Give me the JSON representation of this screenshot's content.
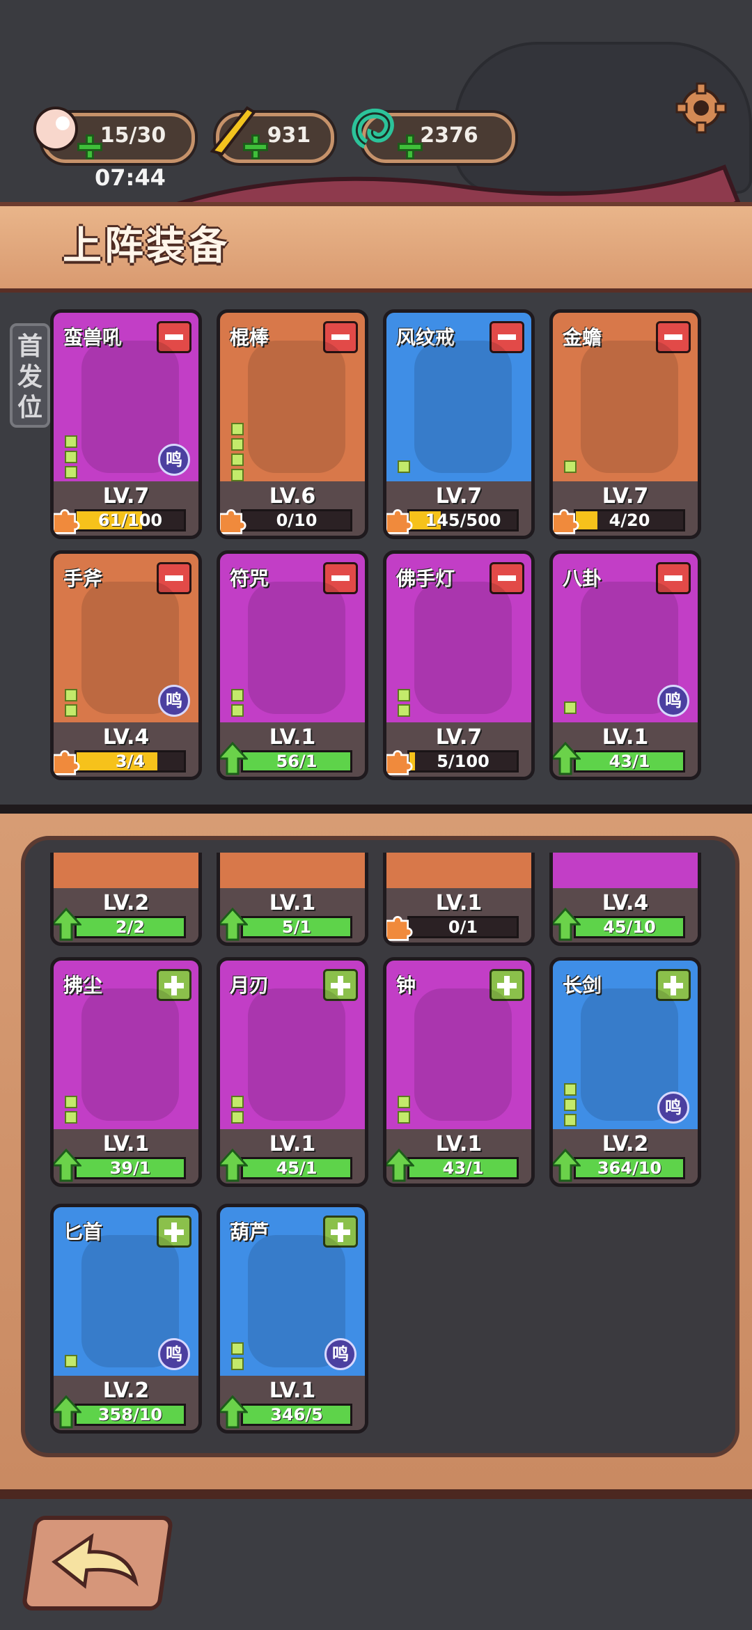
{
  "colors": {
    "purple": "#c23ec6",
    "orange": "#d8784a",
    "blue": "#3f8ee6",
    "bar_yellow": "#f6c21b",
    "bar_green": "#5ed34a"
  },
  "resources": [
    {
      "icon": "peach-icon",
      "value": "15/30"
    },
    {
      "icon": "gold-feather-icon",
      "value": "931"
    },
    {
      "icon": "jade-icon",
      "value": "2376"
    }
  ],
  "timer": "07:44",
  "banner_title": "上阵装备",
  "first_position_tab": "首发位",
  "ming_label": "鸣",
  "equipped": [
    {
      "name": "蛮兽吼",
      "level": "LV.7",
      "progress": "61/100",
      "fill": 0.61,
      "bg": "purple",
      "bar": "yellow",
      "ming": true,
      "pips": 3,
      "badge": "puzzle"
    },
    {
      "name": "棍棒",
      "level": "LV.6",
      "progress": "0/10",
      "fill": 0.0,
      "bg": "orange",
      "bar": "yellow",
      "ming": false,
      "pips": 4,
      "badge": "puzzle"
    },
    {
      "name": "风纹戒",
      "level": "LV.7",
      "progress": "145/500",
      "fill": 0.29,
      "bg": "blue",
      "bar": "yellow",
      "ming": false,
      "pips": 1,
      "badge": "puzzle"
    },
    {
      "name": "金蟾",
      "level": "LV.7",
      "progress": "4/20",
      "fill": 0.2,
      "bg": "orange",
      "bar": "yellow",
      "ming": false,
      "pips": 1,
      "badge": "puzzle"
    },
    {
      "name": "手斧",
      "level": "LV.4",
      "progress": "3/4",
      "fill": 0.75,
      "bg": "orange",
      "bar": "yellow",
      "ming": true,
      "pips": 2,
      "badge": "puzzle"
    },
    {
      "name": "符咒",
      "level": "LV.1",
      "progress": "56/1",
      "fill": 1.0,
      "bg": "purple",
      "bar": "green",
      "ming": false,
      "pips": 2,
      "badge": "arrow"
    },
    {
      "name": "佛手灯",
      "level": "LV.7",
      "progress": "5/100",
      "fill": 0.05,
      "bg": "purple",
      "bar": "yellow",
      "ming": false,
      "pips": 2,
      "badge": "puzzle"
    },
    {
      "name": "八卦",
      "level": "LV.1",
      "progress": "43/1",
      "fill": 1.0,
      "bg": "purple",
      "bar": "green",
      "ming": true,
      "pips": 1,
      "badge": "arrow"
    }
  ],
  "inventory_partial": [
    {
      "level": "LV.2",
      "progress": "2/2",
      "fill": 1.0,
      "bg": "orange",
      "bar": "green",
      "badge": "arrow"
    },
    {
      "level": "LV.1",
      "progress": "5/1",
      "fill": 1.0,
      "bg": "orange",
      "bar": "green",
      "badge": "arrow"
    },
    {
      "level": "LV.1",
      "progress": "0/1",
      "fill": 0.0,
      "bg": "orange",
      "bar": "yellow",
      "badge": "puzzle"
    },
    {
      "level": "LV.4",
      "progress": "45/10",
      "fill": 1.0,
      "bg": "purple",
      "bar": "green",
      "badge": "arrow"
    }
  ],
  "inventory": [
    {
      "name": "拂尘",
      "level": "LV.1",
      "progress": "39/1",
      "fill": 1.0,
      "bg": "purple",
      "bar": "green",
      "ming": false,
      "pips": 2,
      "badge": "arrow"
    },
    {
      "name": "月刃",
      "level": "LV.1",
      "progress": "45/1",
      "fill": 1.0,
      "bg": "purple",
      "bar": "green",
      "ming": false,
      "pips": 2,
      "badge": "arrow"
    },
    {
      "name": "钟",
      "level": "LV.1",
      "progress": "43/1",
      "fill": 1.0,
      "bg": "purple",
      "bar": "green",
      "ming": false,
      "pips": 2,
      "badge": "arrow"
    },
    {
      "name": "长剑",
      "level": "LV.2",
      "progress": "364/10",
      "fill": 1.0,
      "bg": "blue",
      "bar": "green",
      "ming": true,
      "pips": 3,
      "badge": "arrow"
    },
    {
      "name": "匕首",
      "level": "LV.2",
      "progress": "358/10",
      "fill": 1.0,
      "bg": "blue",
      "bar": "green",
      "ming": true,
      "pips": 1,
      "badge": "arrow"
    },
    {
      "name": "葫芦",
      "level": "LV.1",
      "progress": "346/5",
      "fill": 1.0,
      "bg": "blue",
      "bar": "green",
      "ming": true,
      "pips": 2,
      "badge": "arrow"
    }
  ]
}
